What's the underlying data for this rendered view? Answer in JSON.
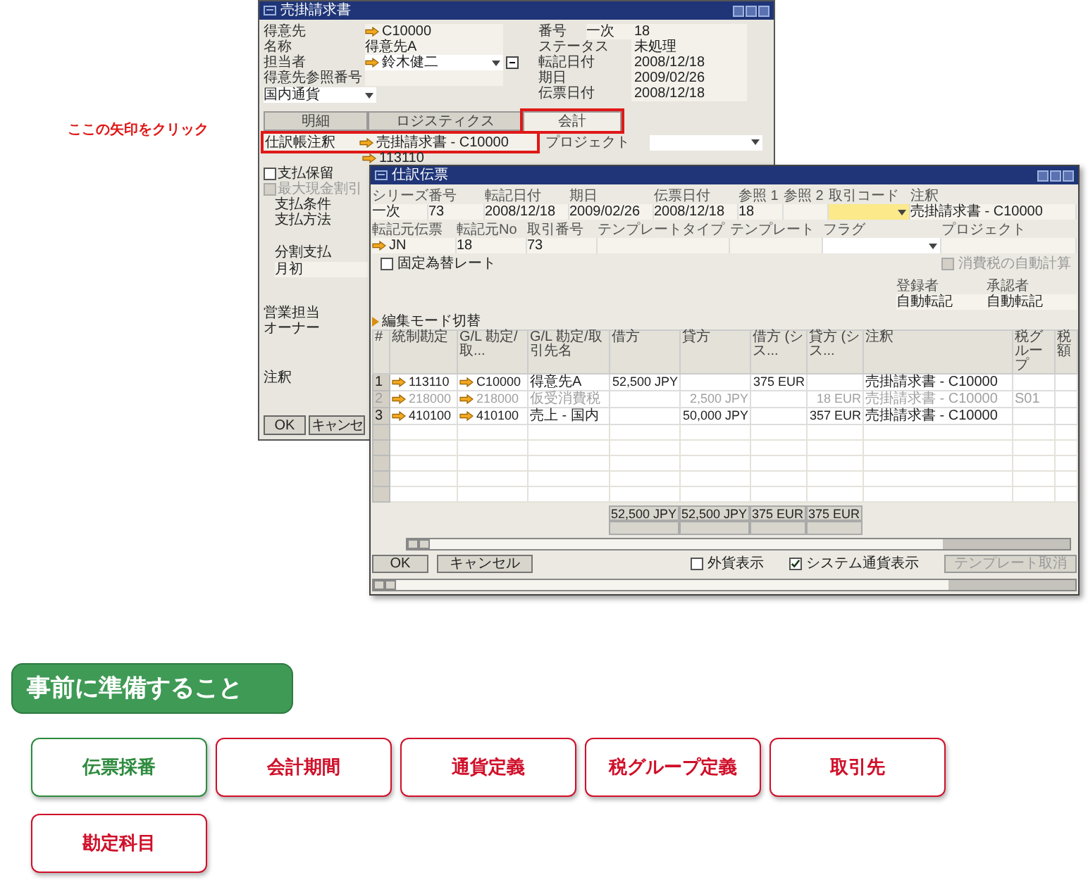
{
  "annotation": "ここの矢印をクリック",
  "invoice_window": {
    "title": "売掛請求書",
    "left_fields": [
      {
        "label": "得意先",
        "value": "C10000",
        "link": true,
        "kind": "text"
      },
      {
        "label": "名称",
        "value": "得意先A",
        "link": false,
        "kind": "text"
      },
      {
        "label": "担当者",
        "value": "鈴木健二",
        "link": true,
        "kind": "dropdown"
      },
      {
        "label": "得意先参照番号",
        "link": false,
        "kind": "text"
      }
    ],
    "currency": "国内通貨",
    "right_fields": [
      {
        "label": "番号",
        "series": "一次",
        "value": "18"
      },
      {
        "label": "ステータス",
        "value": "未処理"
      },
      {
        "label": "転記日付",
        "value": "2008/12/18"
      },
      {
        "label": "期日",
        "value": "2009/02/26"
      },
      {
        "label": "伝票日付",
        "value": "2008/12/18"
      }
    ],
    "tabs": [
      {
        "label": "明細",
        "selected": false,
        "highlighted": false
      },
      {
        "label": "ロジスティクス",
        "selected": false,
        "highlighted": false
      },
      {
        "label": "会計",
        "selected": true,
        "highlighted": true
      }
    ],
    "journal_memo": {
      "label": "仕訳帳注釈",
      "value": "売掛請求書 - C10000",
      "highlighted": true
    },
    "project_label": "プロジェクト",
    "account_code": "113110",
    "checkboxes": [
      {
        "label": "支払保留",
        "checked": false,
        "disabled": false
      },
      {
        "label": "最大現金割引",
        "checked": false,
        "disabled": true
      }
    ],
    "payment_labels": [
      "支払条件",
      "支払方法",
      "分割支払"
    ],
    "installment_value": "月初",
    "staff_labels": [
      "営業担当",
      "オーナー"
    ],
    "remarks_label": "注釈",
    "buttons": [
      "OK",
      "キャンセ"
    ]
  },
  "journal_window": {
    "title": "仕訳伝票",
    "header_fields": [
      {
        "label": "シリーズ",
        "value": "一次",
        "kind": "text"
      },
      {
        "label": "番号",
        "value": "73",
        "kind": "text"
      },
      {
        "label": "転記日付",
        "value": "2008/12/18",
        "kind": "text"
      },
      {
        "label": "期日",
        "value": "2009/02/26",
        "kind": "text"
      },
      {
        "label": "伝票日付",
        "value": "2008/12/18",
        "kind": "text"
      },
      {
        "label": "参照 1",
        "value": "18",
        "kind": "text"
      },
      {
        "label": "参照 2",
        "kind": "text"
      },
      {
        "label": "取引コード",
        "kind": "dropdown",
        "focused": true
      },
      {
        "label": "注釈",
        "value": "売掛請求書 - C10000",
        "kind": "text"
      }
    ],
    "source_fields": [
      {
        "label": "転記元伝票",
        "value": "JN",
        "link": true,
        "kind": "text"
      },
      {
        "label": "転記元No",
        "value": "18",
        "link": false,
        "kind": "text"
      },
      {
        "label": "取引番号",
        "value": "73",
        "link": false,
        "kind": "text"
      },
      {
        "label": "テンプレートタイプ",
        "link": false,
        "kind": "text"
      },
      {
        "label": "テンプレート",
        "link": false,
        "kind": "text"
      },
      {
        "label": "フラグ",
        "link": false,
        "kind": "dropdown"
      },
      {
        "label": "プロジェクト",
        "link": false,
        "kind": "text"
      }
    ],
    "fixed_rate": {
      "label": "固定為替レート",
      "checked": false,
      "disabled": false
    },
    "auto_tax": {
      "label": "消費税の自動計算",
      "checked": false,
      "disabled": true
    },
    "signers": [
      {
        "label": "登録者",
        "value": "自動転記"
      },
      {
        "label": "承認者",
        "value": "自動転記"
      }
    ],
    "edit_mode": "編集モード切替",
    "table": {
      "columns": [
        "#",
        "統制勘定",
        "G/L 勘定/取...",
        "G/L 勘定/取引先名",
        "借方",
        "貸方",
        "借方 (シス...",
        "貸方 (シス...",
        "注釈",
        "税グループ",
        "税額"
      ],
      "rows": [
        {
          "num": "1",
          "account": "113110",
          "gl": "C10000",
          "gl_name": "得意先A",
          "debit": "52,500 JPY",
          "debit_sys": "375 EUR",
          "memo": "売掛請求書 - C10000",
          "disabled": false
        },
        {
          "num": "2",
          "account": "218000",
          "gl": "218000",
          "gl_name": "仮受消費税",
          "credit": "2,500 JPY",
          "credit_sys": "18 EUR",
          "memo": "売掛請求書 - C10000",
          "tax_group": "S01",
          "disabled": true
        },
        {
          "num": "3",
          "account": "410100",
          "gl": "410100",
          "gl_name": "売上 - 国内",
          "credit": "50,000 JPY",
          "credit_sys": "357 EUR",
          "memo": "売掛請求書 - C10000",
          "disabled": false
        }
      ],
      "totals": [
        "52,500 JPY",
        "52,500 JPY",
        "375 EUR",
        "375 EUR"
      ]
    },
    "buttons": [
      "OK",
      "キャンセル"
    ],
    "options": [
      {
        "label": "外貨表示",
        "checked": false
      },
      {
        "label": "システム通貨表示",
        "checked": true
      }
    ],
    "template_button": {
      "label": "テンプレート取消",
      "disabled": true
    }
  },
  "preparation": {
    "title": "事前に準備すること",
    "items": [
      {
        "label": "伝票採番",
        "color": "#2e8b3e"
      },
      {
        "label": "会計期間",
        "color": "#d0102a"
      },
      {
        "label": "通貨定義",
        "color": "#d0102a"
      },
      {
        "label": "税グループ定義",
        "color": "#d0102a"
      },
      {
        "label": "取引先",
        "color": "#d0102a"
      },
      {
        "label": "勘定科目",
        "color": "#d0102a"
      }
    ]
  }
}
